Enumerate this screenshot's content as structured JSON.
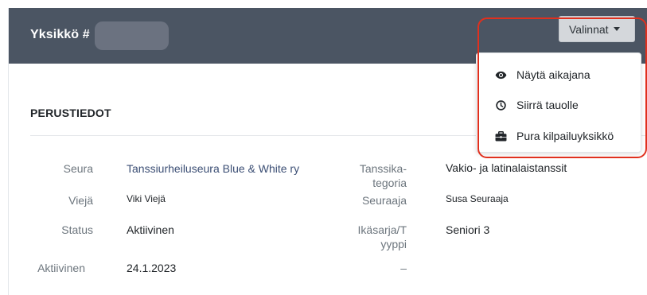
{
  "header": {
    "title": "Yksikkö #",
    "options_button": "Valinnat"
  },
  "menu": {
    "items": [
      {
        "label": "Näytä aikajana",
        "icon": "eye-icon"
      },
      {
        "label": "Siirrä tauolle",
        "icon": "clock-icon"
      },
      {
        "label": "Pura kilpailuyksikkö",
        "icon": "briefcase-icon"
      }
    ]
  },
  "section": {
    "title": "PERUSTIEDOT"
  },
  "fields": {
    "seura_label": "Seura",
    "seura_value": "Tanssiurheiluseura Blue & White ry",
    "tanssikategoria_label_1": "Tanssika-",
    "tanssikategoria_label_2": "tegoria",
    "tanssikategoria_value": "Vakio- ja latinalaistanssit",
    "vieja_label": "Viejä",
    "vieja_value": "Viki Viejä",
    "seuraaja_label": "Seuraaja",
    "seuraaja_value": "Susa Seuraaja",
    "status_label": "Status",
    "status_value": "Aktiivinen",
    "ikasarja_label_1": "Ikäsarja/T",
    "ikasarja_label_2": "yyppi",
    "ikasarja_value": "Seniori 3",
    "aktiivinen_label": "Aktiivinen",
    "aktiivinen_value": "24.1.2023",
    "empty_value": "–"
  },
  "colors": {
    "header_bg": "#4b5563",
    "highlight": "#e0301e",
    "link": "#3b4e74"
  }
}
